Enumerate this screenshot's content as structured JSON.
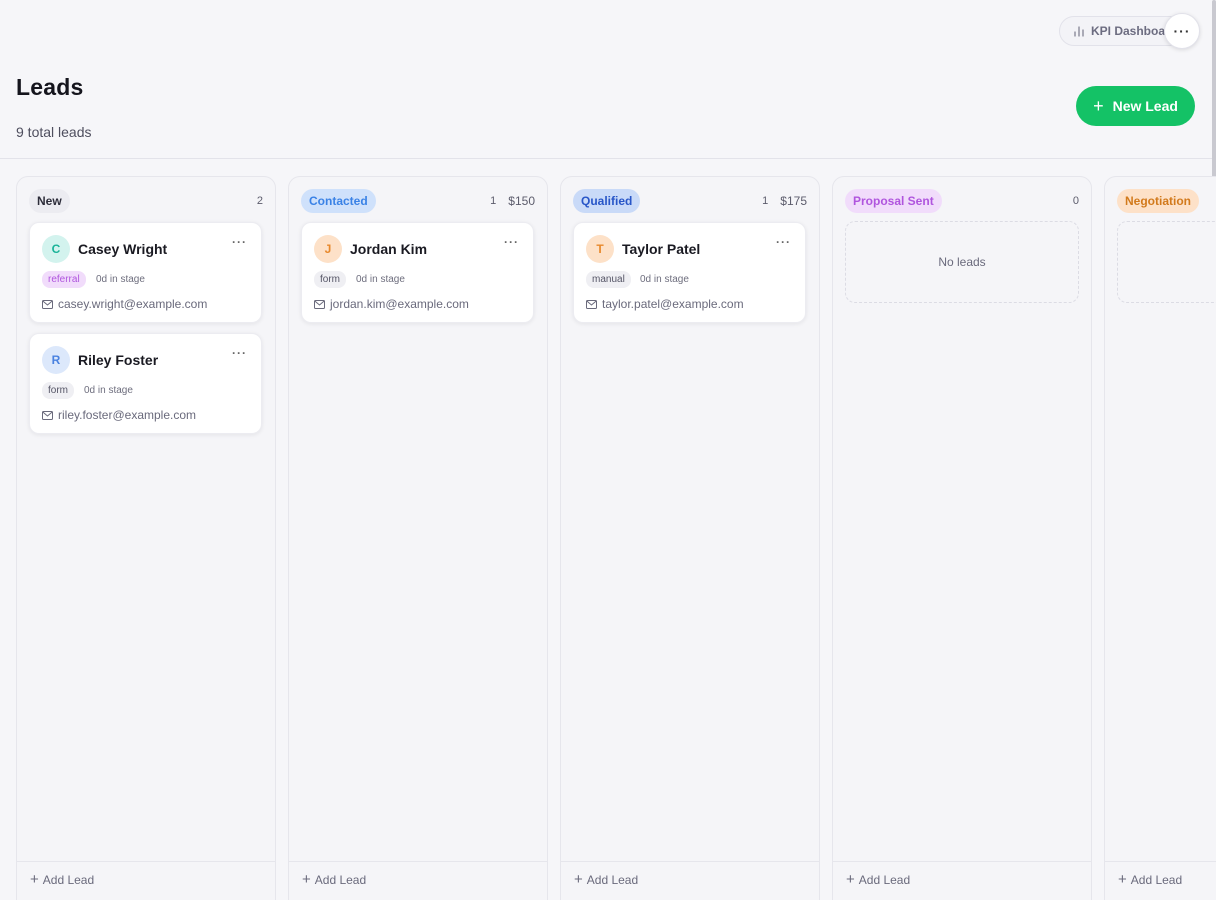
{
  "header": {
    "kpi_label": "KPI Dashboard",
    "more_label": "···",
    "title": "Leads",
    "subtitle": "9 total leads",
    "new_lead_label": "New Lead",
    "new_lead_icon": "+"
  },
  "colors": {
    "accent": "#14c266",
    "background": "#f6f6f9"
  },
  "columns": [
    {
      "name": "New",
      "count": "2",
      "amount": "",
      "pill_bg": "#ececf1",
      "pill_fg": "#2d2d3a",
      "empty_label": "",
      "add_label": "Add Lead",
      "cards": [
        {
          "initial": "C",
          "name": "Casey Wright",
          "source": "referral",
          "stage_time": "0d in stage",
          "email": "casey.wright@example.com",
          "avatar_bg": "#d3f3ee",
          "avatar_fg": "#1bb399",
          "tag_bg": "#f1dcfb",
          "tag_fg": "#b055de"
        },
        {
          "initial": "R",
          "name": "Riley Foster",
          "source": "form",
          "stage_time": "0d in stage",
          "email": "riley.foster@example.com",
          "avatar_bg": "#dce8fb",
          "avatar_fg": "#4a82e0",
          "tag_bg": "#efeff3",
          "tag_fg": "#555566"
        }
      ]
    },
    {
      "name": "Contacted",
      "count": "1",
      "amount": "$150",
      "pill_bg": "#cfe1fb",
      "pill_fg": "#3a82e6",
      "empty_label": "",
      "add_label": "Add Lead",
      "cards": [
        {
          "initial": "J",
          "name": "Jordan Kim",
          "source": "form",
          "stage_time": "0d in stage",
          "email": "jordan.kim@example.com",
          "avatar_bg": "#fde1c8",
          "avatar_fg": "#e8892c",
          "tag_bg": "#efeff3",
          "tag_fg": "#555566"
        }
      ]
    },
    {
      "name": "Qualified",
      "count": "1",
      "amount": "$175",
      "pill_bg": "#c9daf8",
      "pill_fg": "#2856c8",
      "empty_label": "",
      "add_label": "Add Lead",
      "cards": [
        {
          "initial": "T",
          "name": "Taylor Patel",
          "source": "manual",
          "stage_time": "0d in stage",
          "email": "taylor.patel@example.com",
          "avatar_bg": "#fde1c8",
          "avatar_fg": "#e8892c",
          "tag_bg": "#efeff3",
          "tag_fg": "#555566"
        }
      ]
    },
    {
      "name": "Proposal Sent",
      "count": "0",
      "amount": "",
      "pill_bg": "#f1dcfb",
      "pill_fg": "#b055de",
      "empty_label": "No leads",
      "add_label": "Add Lead",
      "cards": []
    },
    {
      "name": "Negotiation",
      "count": "",
      "amount": "",
      "pill_bg": "#fde1c8",
      "pill_fg": "#d27a1c",
      "empty_label": "",
      "add_label": "Add Lead",
      "cards": []
    }
  ]
}
